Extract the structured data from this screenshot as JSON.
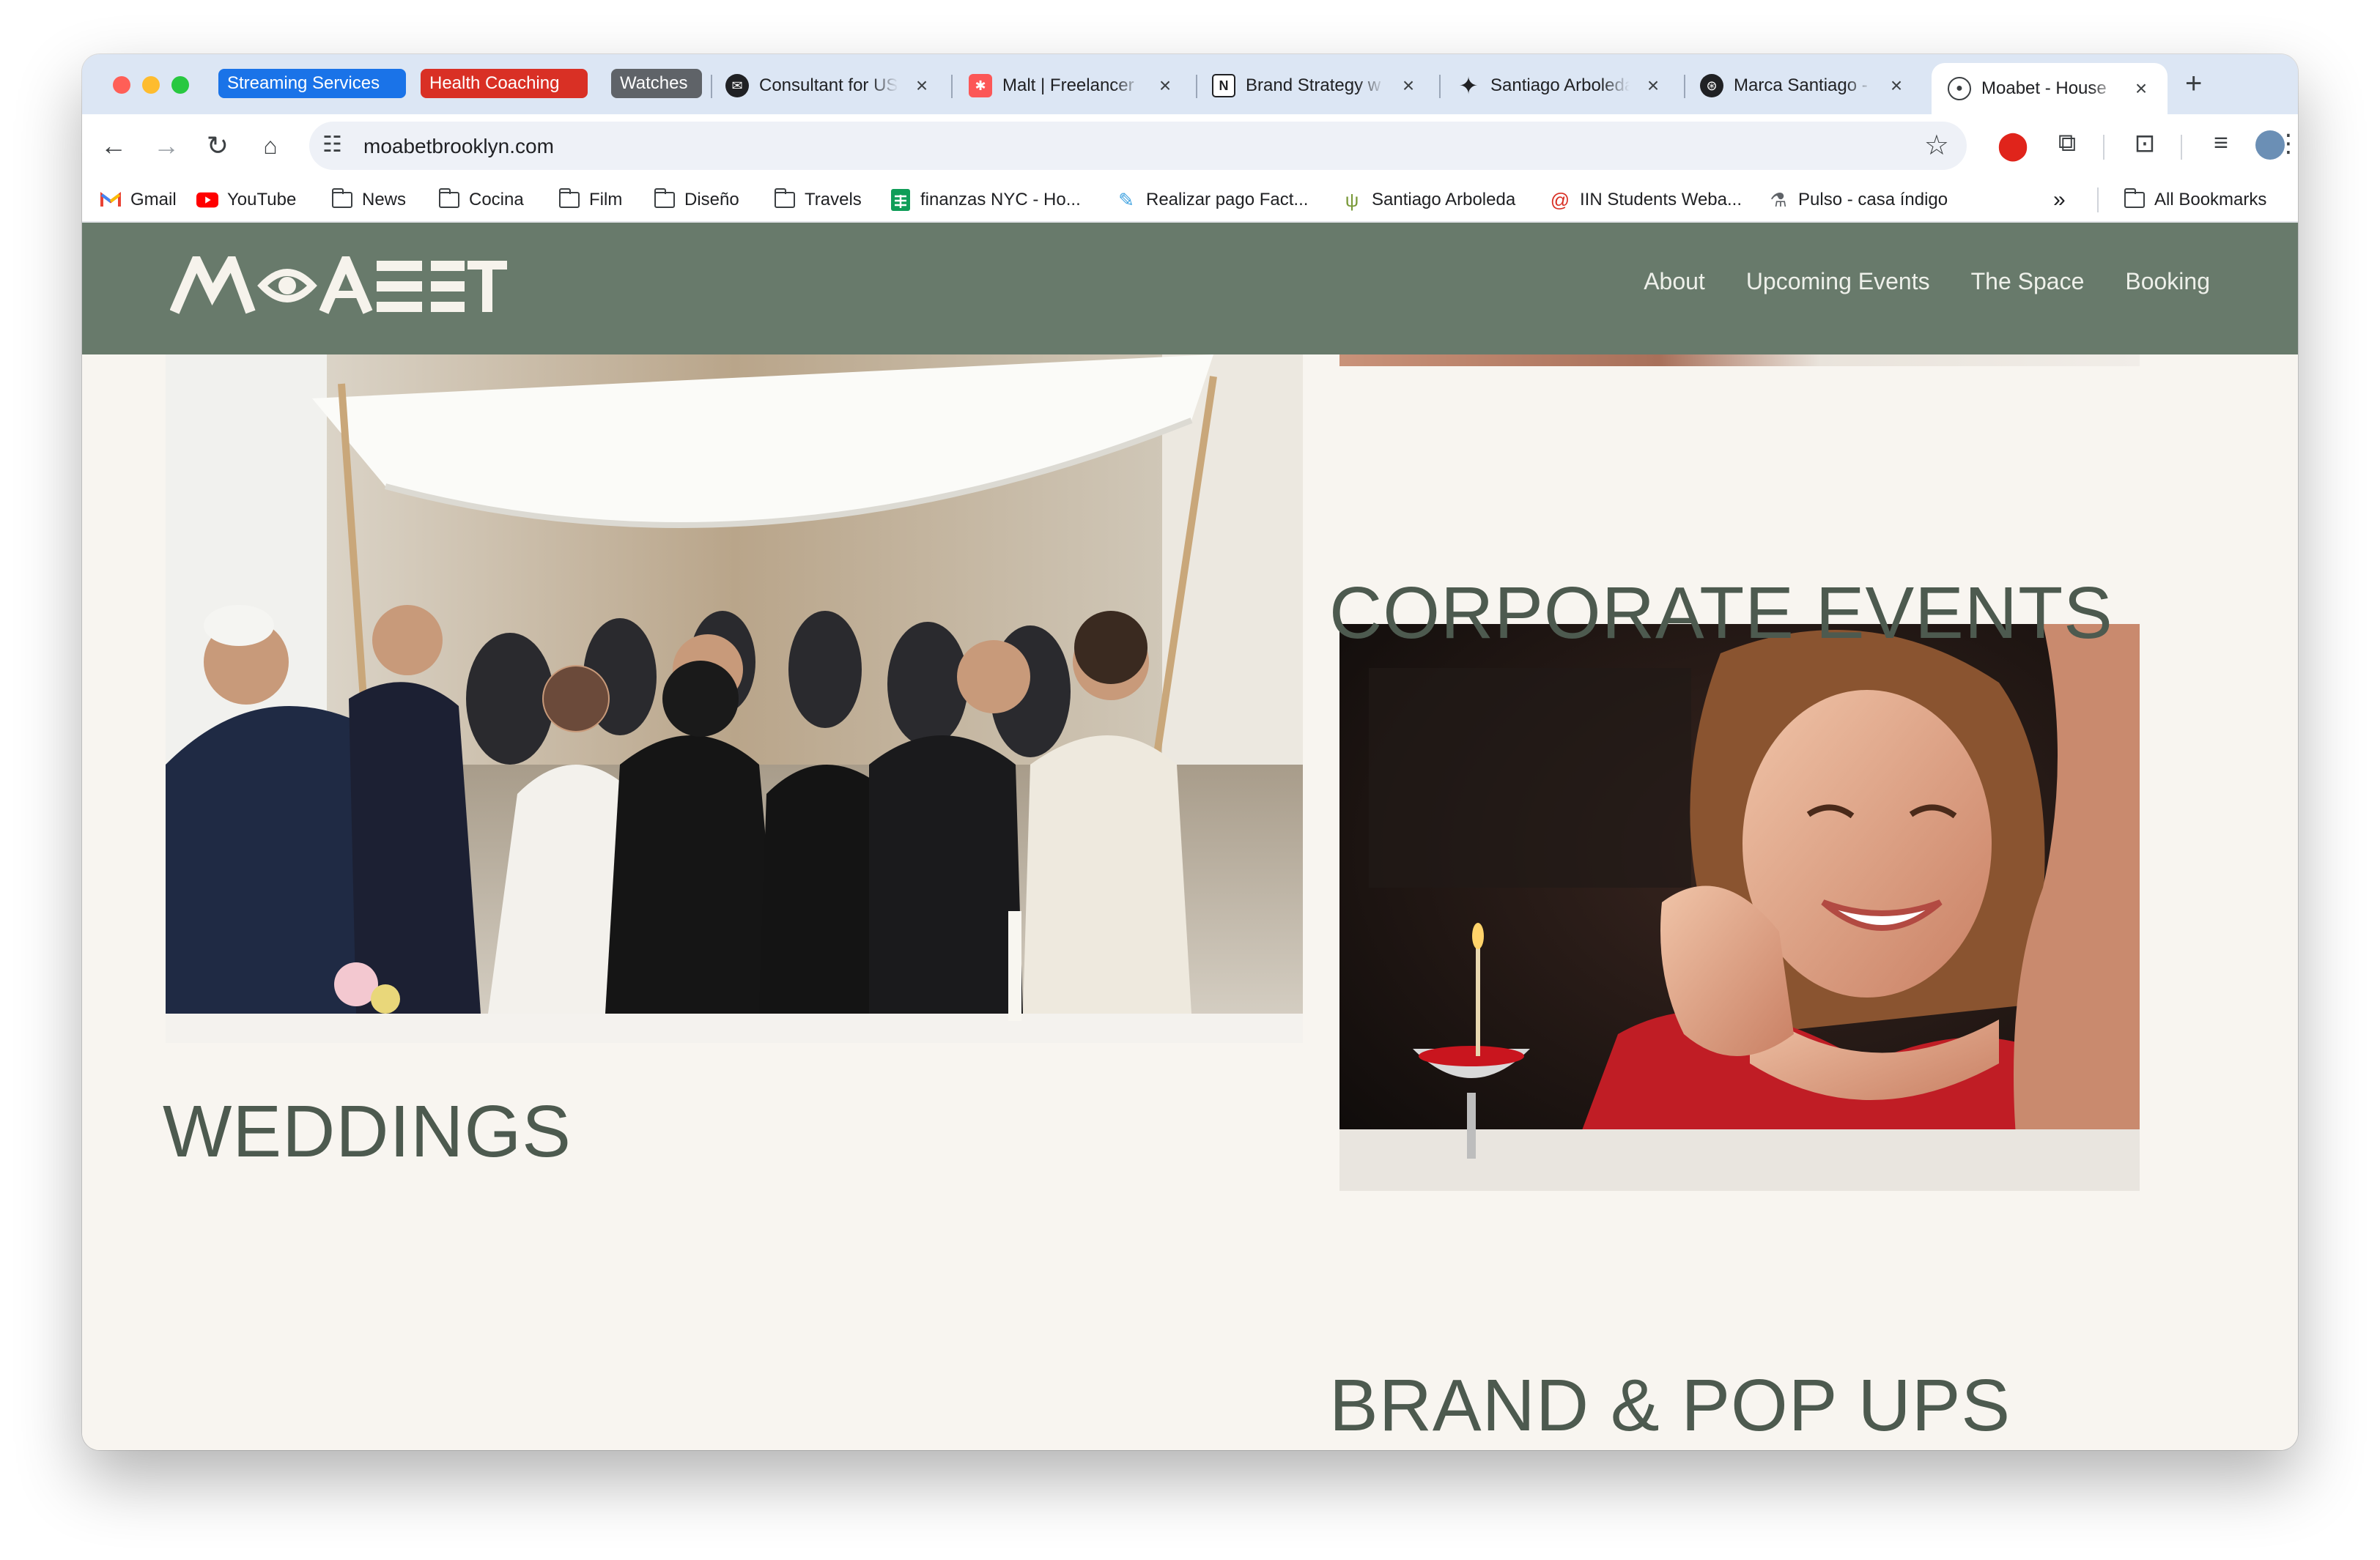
{
  "browser": {
    "tab_groups": [
      {
        "label": "Streaming Services",
        "color": "#1a73e8"
      },
      {
        "label": "Health Coaching",
        "color": "#d93025"
      },
      {
        "label": "Watches",
        "color": "#5f6368"
      }
    ],
    "tabs": [
      {
        "title": "Consultant for US",
        "icon": "envelope-x-icon"
      },
      {
        "title": "Malt | Freelancer",
        "icon": "malt-icon"
      },
      {
        "title": "Brand Strategy w",
        "icon": "notion-icon"
      },
      {
        "title": "Santiago Arboleda",
        "icon": "sparkle-icon"
      },
      {
        "title": "Marca Santiago -",
        "icon": "openai-icon"
      },
      {
        "title": "Moabet - House",
        "icon": "eye-icon",
        "active": true
      }
    ],
    "url": "moabetbrooklyn.com",
    "bookmarks": [
      {
        "label": "Gmail",
        "icon": "gmail-icon"
      },
      {
        "label": "YouTube",
        "icon": "youtube-icon"
      },
      {
        "label": "News",
        "icon": "folder-icon"
      },
      {
        "label": "Cocina",
        "icon": "folder-icon"
      },
      {
        "label": "Film",
        "icon": "folder-icon"
      },
      {
        "label": "Diseño",
        "icon": "folder-icon"
      },
      {
        "label": "Travels",
        "icon": "folder-icon"
      },
      {
        "label": "finanzas NYC - Ho...",
        "icon": "sheets-icon"
      },
      {
        "label": "Realizar pago Fact...",
        "icon": "pen-icon"
      },
      {
        "label": "Santiago Arboleda",
        "icon": "cactus-icon"
      },
      {
        "label": "IIN Students Weba...",
        "icon": "spiral-icon"
      },
      {
        "label": "Pulso - casa índigo",
        "icon": "flask-icon"
      }
    ],
    "all_bookmarks": "All Bookmarks"
  },
  "site": {
    "logo": "MOABET",
    "nav": [
      "About",
      "Upcoming Events",
      "The Space",
      "Booking"
    ],
    "sections": {
      "weddings": "WEDDINGS",
      "corporate": "CORPORATE EVENTS",
      "brand": "BRAND & POP UPS"
    }
  },
  "colors": {
    "nav_bg": "#687a6b",
    "page_bg": "#f8f5f0",
    "heading": "#4d5a4f"
  }
}
